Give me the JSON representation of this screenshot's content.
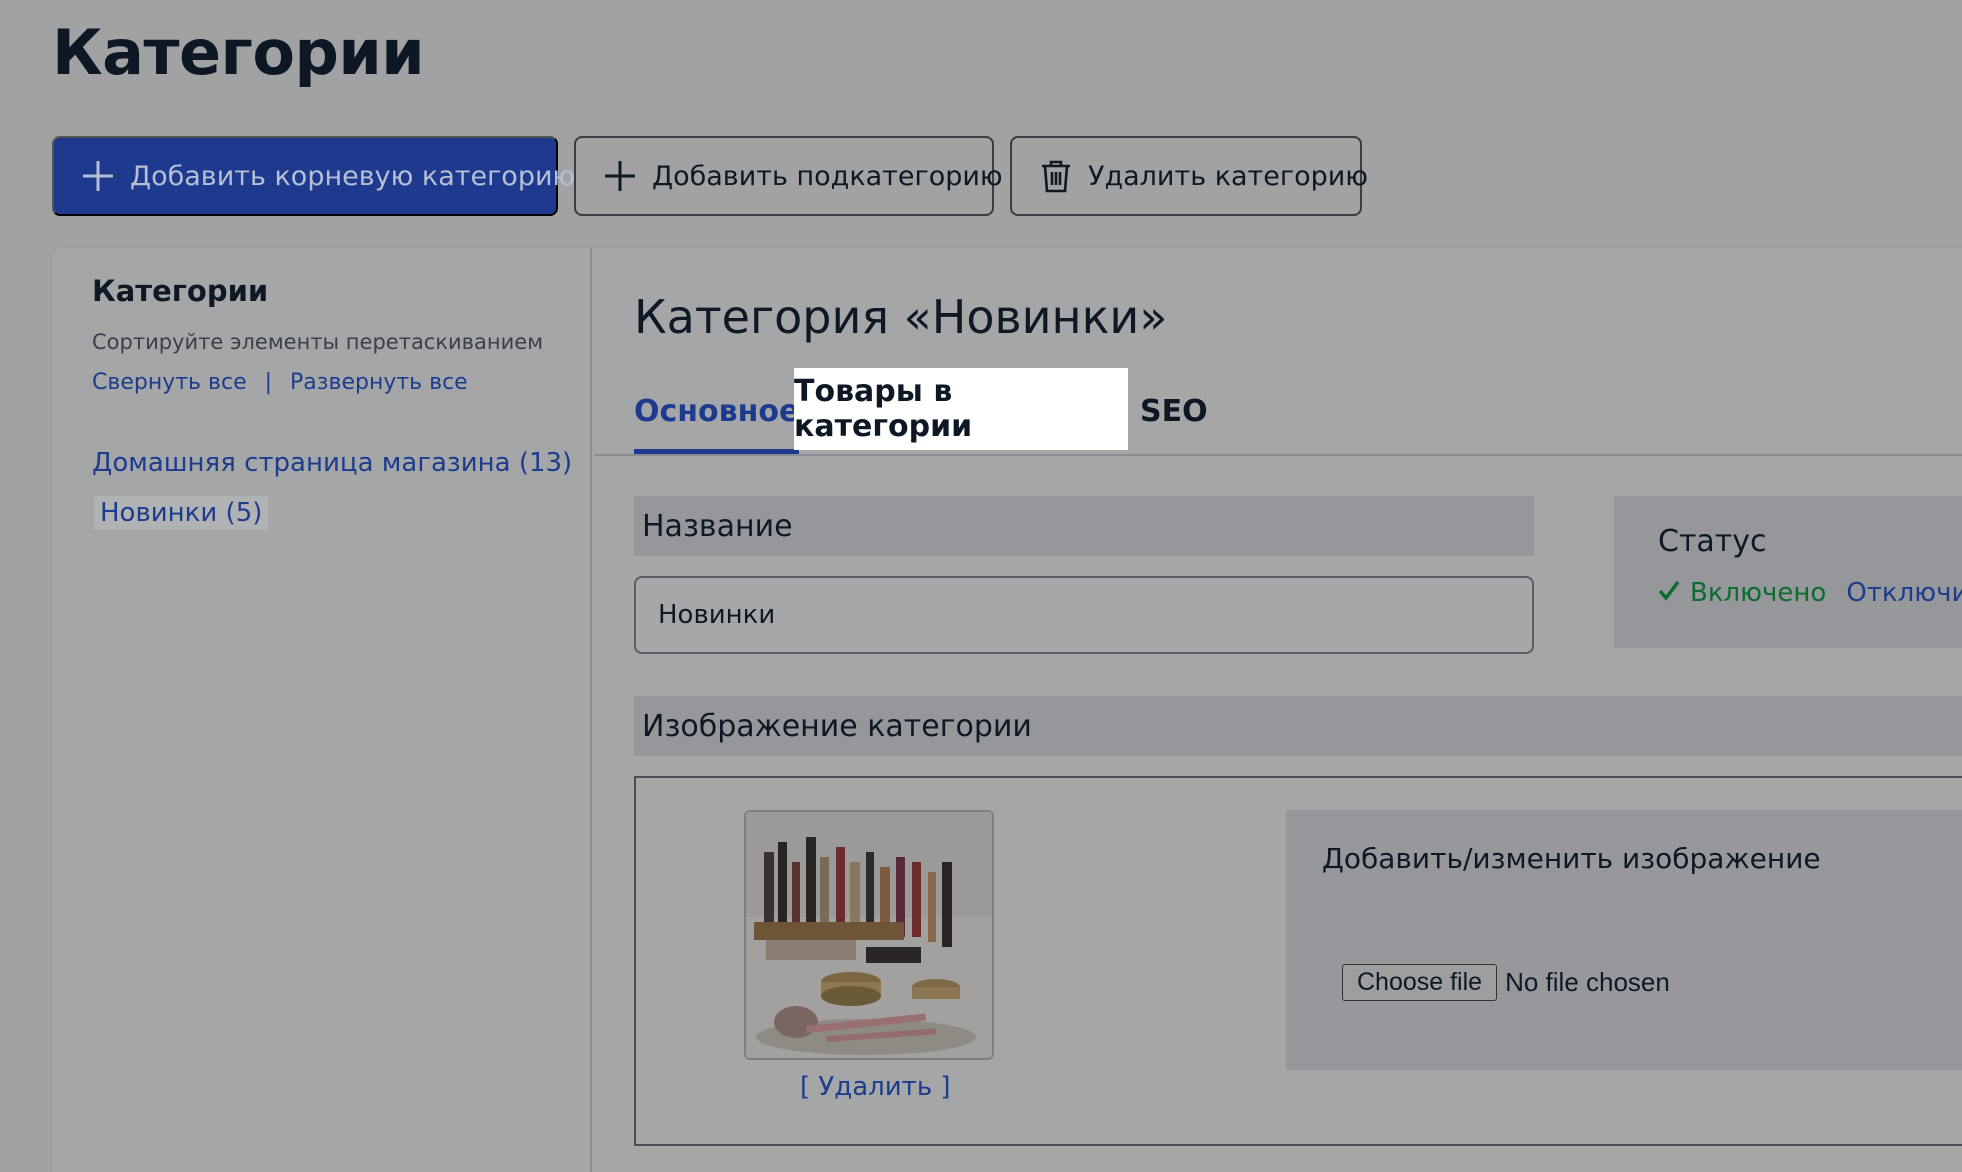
{
  "page": {
    "title": "Категории"
  },
  "toolbar": {
    "add_root_label": "Добавить корневую категорию",
    "add_sub_label": "Добавить подкатегорию",
    "delete_label": "Удалить категорию"
  },
  "sidebar": {
    "title": "Категории",
    "hint": "Сортируйте элементы перетаскиванием",
    "collapse_all": "Свернуть все",
    "separator": "|",
    "expand_all": "Развернуть все",
    "items": [
      {
        "label": "Домашняя страница магазина (13)",
        "selected": false
      },
      {
        "label": "Новинки (5)",
        "selected": true
      }
    ]
  },
  "main": {
    "title": "Категория «Новинки»",
    "tabs": [
      {
        "label": "Основное",
        "active": true
      },
      {
        "label": "Товары в категории",
        "highlighted": true
      },
      {
        "label": "SEO"
      }
    ],
    "name_section": {
      "heading": "Название",
      "value": "Новинки"
    },
    "status": {
      "heading": "Статус",
      "enabled_label": "Включено",
      "disable_link": "Отключить",
      "icon": "check-icon"
    },
    "image_section": {
      "heading": "Изображение категории",
      "delete_link": "[ Удалить ]",
      "upload_title": "Добавить/изменить изображение",
      "choose_file_label": "Choose file",
      "no_file_text": "No file chosen"
    }
  },
  "colors": {
    "primary": "#1d3a8f",
    "link": "#1e3c8c",
    "status_on": "#0e6b2e"
  }
}
